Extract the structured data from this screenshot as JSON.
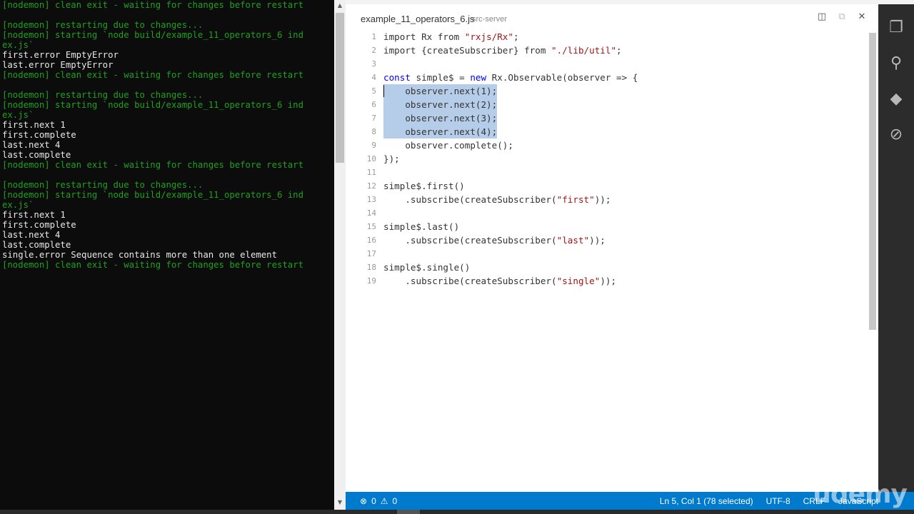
{
  "terminal": {
    "lines": [
      {
        "t": "[nodemon] clean exit - waiting for changes before restart",
        "c": "g"
      },
      {
        "t": "",
        "c": "w"
      },
      {
        "t": "[nodemon] restarting due to changes...",
        "c": "g"
      },
      {
        "t": "[nodemon] starting `node build/example_11_operators_6 ind",
        "c": "g"
      },
      {
        "t": "ex.js`",
        "c": "g"
      },
      {
        "t": "first.error EmptyError",
        "c": "w"
      },
      {
        "t": "last.error EmptyError",
        "c": "w"
      },
      {
        "t": "[nodemon] clean exit - waiting for changes before restart",
        "c": "g"
      },
      {
        "t": "",
        "c": "w"
      },
      {
        "t": "[nodemon] restarting due to changes...",
        "c": "g"
      },
      {
        "t": "[nodemon] starting `node build/example_11_operators_6 ind",
        "c": "g"
      },
      {
        "t": "ex.js`",
        "c": "g"
      },
      {
        "t": "first.next 1",
        "c": "w"
      },
      {
        "t": "first.complete",
        "c": "w"
      },
      {
        "t": "last.next 4",
        "c": "w"
      },
      {
        "t": "last.complete",
        "c": "w"
      },
      {
        "t": "[nodemon] clean exit - waiting for changes before restart",
        "c": "g"
      },
      {
        "t": "",
        "c": "w"
      },
      {
        "t": "[nodemon] restarting due to changes...",
        "c": "g"
      },
      {
        "t": "[nodemon] starting `node build/example_11_operators_6 ind",
        "c": "g"
      },
      {
        "t": "ex.js`",
        "c": "g"
      },
      {
        "t": "first.next 1",
        "c": "w"
      },
      {
        "t": "first.complete",
        "c": "w"
      },
      {
        "t": "last.next 4",
        "c": "w"
      },
      {
        "t": "last.complete",
        "c": "w"
      },
      {
        "t": "single.error Sequence contains more than one element",
        "c": "w"
      },
      {
        "t": "[nodemon] clean exit - waiting for changes before restart",
        "c": "g"
      }
    ]
  },
  "editor": {
    "tab_title": "example_11_operators_6.js",
    "tab_path": "src-server",
    "actions": {
      "split": "◫",
      "open": "⧉",
      "close": "✕"
    },
    "code": [
      {
        "n": "1",
        "parts": [
          [
            "kw0",
            "import Rx from "
          ],
          [
            "str",
            "\"rxjs/Rx\""
          ],
          [
            "kw0",
            ";"
          ]
        ]
      },
      {
        "n": "2",
        "parts": [
          [
            "kw0",
            "import {createSubscriber} from "
          ],
          [
            "str",
            "\"./lib/util\""
          ],
          [
            "kw0",
            ";"
          ]
        ]
      },
      {
        "n": "3",
        "parts": []
      },
      {
        "n": "4",
        "parts": [
          [
            "kw",
            "const"
          ],
          [
            "kw0",
            " simple$ = "
          ],
          [
            "kw",
            "new"
          ],
          [
            "kw0",
            " Rx.Observable(observer => {"
          ]
        ]
      },
      {
        "n": "5",
        "sel": true,
        "caret": true,
        "parts": [
          [
            "kw0",
            "    observer.next(1);"
          ]
        ]
      },
      {
        "n": "6",
        "sel": true,
        "parts": [
          [
            "kw0",
            "    observer.next(2);"
          ]
        ]
      },
      {
        "n": "7",
        "sel": true,
        "parts": [
          [
            "kw0",
            "    observer.next(3);"
          ]
        ]
      },
      {
        "n": "8",
        "sel": true,
        "parts": [
          [
            "kw0",
            "    observer.next(4);"
          ]
        ]
      },
      {
        "n": "9",
        "parts": [
          [
            "kw0",
            "    observer.complete();"
          ]
        ]
      },
      {
        "n": "10",
        "parts": [
          [
            "kw0",
            "});"
          ]
        ]
      },
      {
        "n": "11",
        "parts": []
      },
      {
        "n": "12",
        "parts": [
          [
            "kw0",
            "simple$.first()"
          ]
        ]
      },
      {
        "n": "13",
        "parts": [
          [
            "kw0",
            "    .subscribe(createSubscriber("
          ],
          [
            "str",
            "\"first\""
          ],
          [
            "kw0",
            "));"
          ]
        ]
      },
      {
        "n": "14",
        "parts": []
      },
      {
        "n": "15",
        "parts": [
          [
            "kw0",
            "simple$.last()"
          ]
        ]
      },
      {
        "n": "16",
        "parts": [
          [
            "kw0",
            "    .subscribe(createSubscriber("
          ],
          [
            "str",
            "\"last\""
          ],
          [
            "kw0",
            "));"
          ]
        ]
      },
      {
        "n": "17",
        "parts": []
      },
      {
        "n": "18",
        "parts": [
          [
            "kw0",
            "simple$.single()"
          ]
        ]
      },
      {
        "n": "19",
        "parts": [
          [
            "kw0",
            "    .subscribe(createSubscriber("
          ],
          [
            "str",
            "\"single\""
          ],
          [
            "kw0",
            "));"
          ]
        ]
      }
    ]
  },
  "activity_bar": [
    {
      "name": "explorer-icon",
      "glyph": "❐"
    },
    {
      "name": "search-icon",
      "glyph": "⚲"
    },
    {
      "name": "git-icon",
      "glyph": "◆"
    },
    {
      "name": "debug-icon",
      "glyph": "⊘"
    }
  ],
  "status": {
    "errors_icon": "⊗",
    "errors": "0",
    "warnings_icon": "⚠",
    "warnings": "0",
    "position": "Ln 5, Col 1 (78 selected)",
    "encoding": "UTF-8",
    "eol": "CRLF",
    "language": "JavaScript"
  },
  "watermark": "udemy"
}
